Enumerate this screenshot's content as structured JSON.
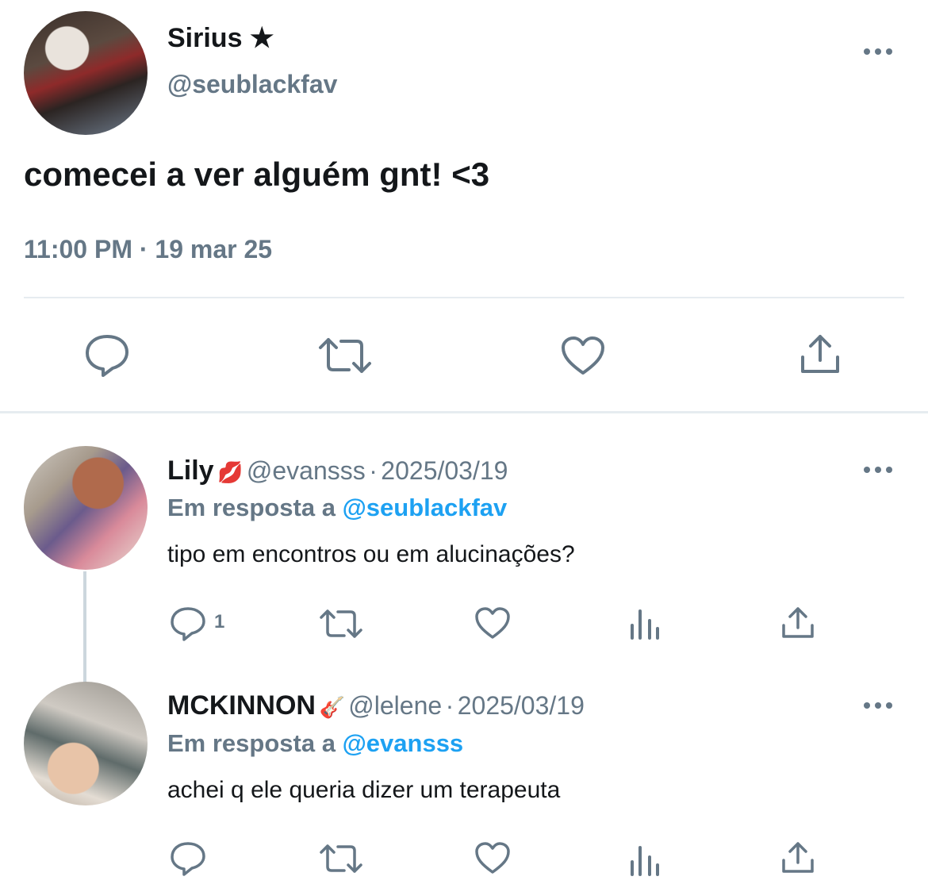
{
  "main_tweet": {
    "name": "Sirius",
    "name_badge": "★",
    "handle": "@seublackfav",
    "text": "comecei a ver alguém gnt! <3",
    "time": "11:00 PM",
    "date_sep": "·",
    "date": "19 mar 25",
    "icons": [
      "reply-icon",
      "retweet-icon",
      "like-icon",
      "share-icon"
    ]
  },
  "replies": [
    {
      "name": "Lily",
      "emoji": "💋",
      "handle": "@evansss",
      "date_sep": "·",
      "date": "2025/03/19",
      "reply_prefix": "Em resposta a",
      "reply_to": "@seublackfav",
      "text": "tipo em encontros ou em alucinações?",
      "reply_count": "1"
    },
    {
      "name": "MCKINNON",
      "emoji": "🎸",
      "handle": "@lelene",
      "date_sep": "·",
      "date": "2025/03/19",
      "reply_prefix": "Em resposta a",
      "reply_to": "@evansss",
      "text": "achei q ele queria dizer um terapeuta",
      "reply_count": ""
    }
  ],
  "colors": {
    "text": "#14171a",
    "secondary": "#657786",
    "link": "#1da1f2",
    "divider": "#e6ecf0"
  }
}
